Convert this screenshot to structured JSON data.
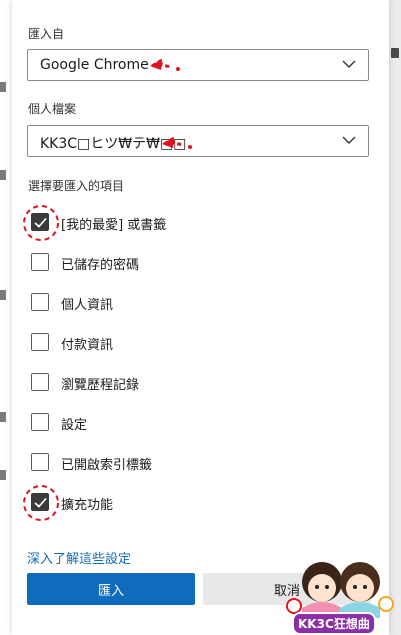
{
  "dialog": {
    "import_from_label": "匯入自",
    "browser_value": "Google Chrome",
    "profile_label": "個人檔案",
    "profile_value": "KK3C□ヒツ₩テ₩□□",
    "choose_label": "選擇要匯入的項目",
    "items": [
      {
        "label": "[我的最愛] 或書籤",
        "checked": true
      },
      {
        "label": "已儲存的密碼",
        "checked": false
      },
      {
        "label": "個人資訊",
        "checked": false
      },
      {
        "label": "付款資訊",
        "checked": false
      },
      {
        "label": "瀏覽歷程記錄",
        "checked": false
      },
      {
        "label": "設定",
        "checked": false
      },
      {
        "label": "已開啟索引標籤",
        "checked": false
      },
      {
        "label": "擴充功能",
        "checked": true
      }
    ],
    "learn_more_link": "深入了解這些設定",
    "import_button": "匯入",
    "cancel_button": "取消"
  },
  "watermark": {
    "text": "KK3C狂想曲"
  },
  "colors": {
    "accent": "#0f6cbd",
    "annotation_red": "#e0141e",
    "checkbox_checked": "#3b3b3b"
  }
}
